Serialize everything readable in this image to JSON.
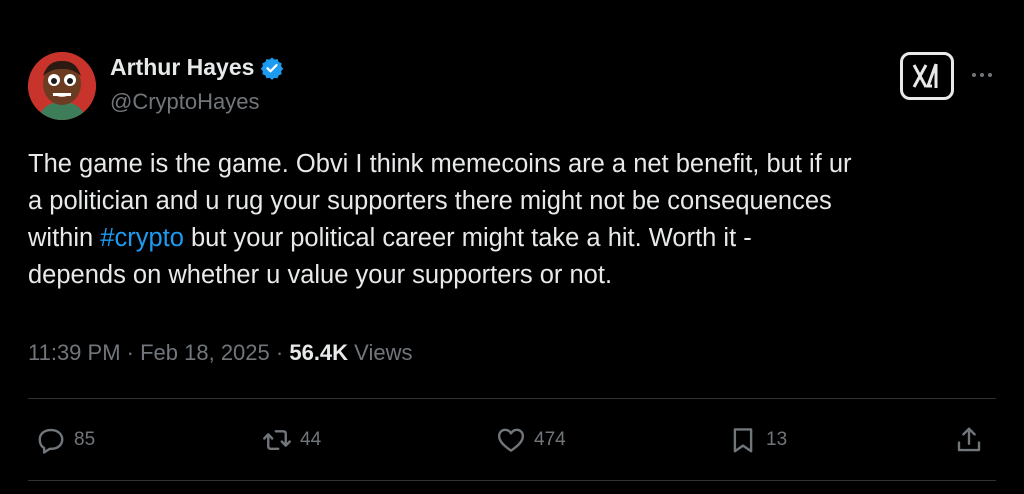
{
  "author": {
    "name": "Arthur Hayes",
    "handle": "@CryptoHayes",
    "verified": true
  },
  "tweet": {
    "line1": "The game is the game. Obvi I think memecoins are a net benefit, but if ur",
    "line2": "a politician and u rug your supporters there might not be consequences",
    "line3_pre": "within ",
    "hashtag": "#crypto",
    "line3_post": " but your political career might take a hit. Worth it -",
    "line4": "depends on whether u value your supporters or not."
  },
  "meta": {
    "time": "11:39 PM",
    "sep1": " · ",
    "date": "Feb 18, 2025",
    "sep2": " · ",
    "views_count": "56.4K",
    "views_label": " Views"
  },
  "actions": {
    "replies": "85",
    "reposts": "44",
    "likes": "474",
    "bookmarks": "13"
  },
  "icons": {
    "verified": "verified-badge-icon",
    "grok": "grok-icon",
    "more": "more-icon",
    "reply": "reply-icon",
    "repost": "repost-icon",
    "like": "heart-icon",
    "bookmark": "bookmark-icon",
    "share": "share-icon"
  },
  "colors": {
    "background": "#000000",
    "text": "#e7e9ea",
    "secondary": "#71767b",
    "accent": "#1d9bf0",
    "divider": "#2f3336"
  }
}
